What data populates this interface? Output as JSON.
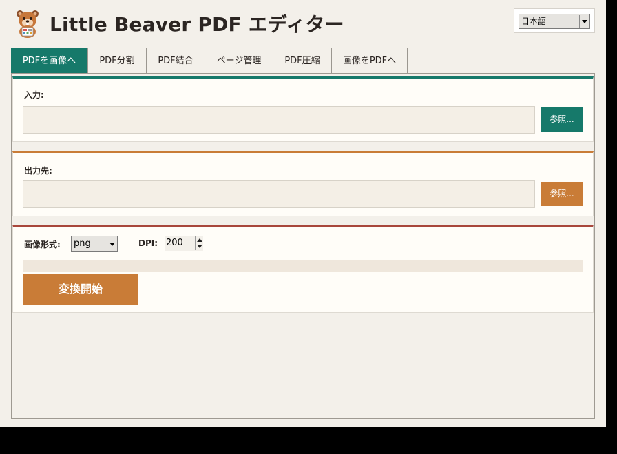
{
  "app": {
    "title": "Little Beaver PDF エディター",
    "logo_icon": "beaver-mascot-icon"
  },
  "language": {
    "selected": "日本語",
    "options": [
      "日本語"
    ]
  },
  "tabs": [
    {
      "label": "PDFを画像へ",
      "active": true
    },
    {
      "label": "PDF分割",
      "active": false
    },
    {
      "label": "PDF結合",
      "active": false
    },
    {
      "label": "ページ管理",
      "active": false
    },
    {
      "label": "PDF圧縮",
      "active": false
    },
    {
      "label": "画像をPDFへ",
      "active": false
    }
  ],
  "input_section": {
    "label": "入力:",
    "value": "",
    "browse_label": "参照..."
  },
  "output_section": {
    "label": "出力先:",
    "value": "",
    "browse_label": "参照..."
  },
  "options": {
    "format_label": "画像形式:",
    "format_value": "png",
    "dpi_label": "DPI:",
    "dpi_value": "200",
    "progress": 0,
    "start_label": "変換開始"
  },
  "colors": {
    "teal": "#16796a",
    "orange": "#c97c37",
    "red_brown": "#a8473c",
    "background": "#f3f0ea"
  }
}
